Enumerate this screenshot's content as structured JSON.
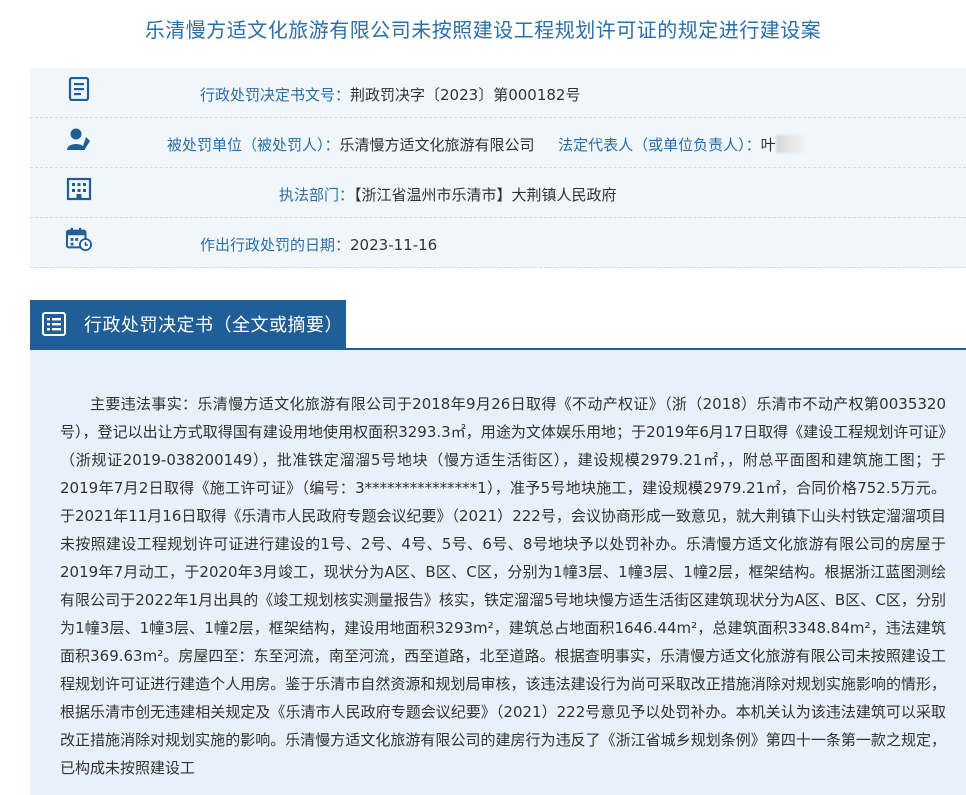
{
  "page_title": "乐清慢方适文化旅游有限公司未按照建设工程规划许可证的规定进行建设案",
  "info_rows": [
    {
      "icon": "document-icon",
      "label": "行政处罚决定书文号：",
      "value": "荆政罚决字〔2023〕第000182号"
    },
    {
      "icon": "person-icon",
      "label": "被处罚单位（被处罚人）：",
      "value": "乐清慢方适文化旅游有限公司",
      "extra_label": "法定代表人（或单位负责人）：",
      "extra_value": "叶"
    },
    {
      "icon": "building-icon",
      "label": "执法部门：",
      "value": "【浙江省温州市乐清市】大荆镇人民政府"
    },
    {
      "icon": "calendar-icon",
      "label": "作出行政处罚的日期：",
      "value": "2023-11-16"
    }
  ],
  "section_tab": {
    "icon": "doc-list-icon",
    "label": "行政处罚决定书（全文或摘要）"
  },
  "decision_text": "主要违法事实：乐清慢方适文化旅游有限公司于2018年9月26日取得《不动产权证》（浙（2018）乐清市不动产权第0035320号），登记以出让方式取得国有建设用地使用权面积3293.3㎡，用途为文体娱乐用地；于2019年6月17日取得《建设工程规划许可证》（浙规证2019-038200149），批准铁定溜溜5号地块（慢方适生活街区），建设规模2979.21㎡，，附总平面图和建筑施工图；于2019年7月2日取得《施工许可证》（编号：3***************1），准予5号地块施工，建设规模2979.21㎡，合同价格752.5万元。于2021年11月16日取得《乐清市人民政府专题会议纪要》（2021）222号，会议协商形成一致意见，就大荆镇下山头村铁定溜溜项目未按照建设工程规划许可证进行建设的1号、2号、4号、5号、6号、8号地块予以处罚补办。乐清慢方适文化旅游有限公司的房屋于2019年7月动工，于2020年3月竣工，现状分为A区、B区、C区，分别为1幢3层、1幢3层、1幢2层，框架结构。根据浙江蓝图测绘有限公司于2022年1月出具的《竣工规划核实测量报告》核实，铁定溜溜5号地块慢方适生活街区建筑现状分为A区、B区、C区，分别为1幢3层、1幢3层、1幢2层，框架结构，建设用地面积3293m²，建筑总占地面积1646.44m²，总建筑面积3348.84m²，违法建筑面积369.63m²。房屋四至：东至河流，南至河流，西至道路，北至道路。根据查明事实，乐清慢方适文化旅游有限公司未按照建设工程规划许可证进行建造个人用房。鉴于乐清市自然资源和规划局审核，该违法建设行为尚可采取改正措施消除对规划实施影响的情形，根据乐清市创无违建相关规定及《乐清市人民政府专题会议纪要》（2021）222号意见予以处罚补办。本机关认为该违法建筑可以采取改正措施消除对规划实施的影响。乐清慢方适文化旅游有限公司的建房行为违反了《浙江省城乡规划条例》第四十一条第一款之规定，已构成未按照建设工"
}
